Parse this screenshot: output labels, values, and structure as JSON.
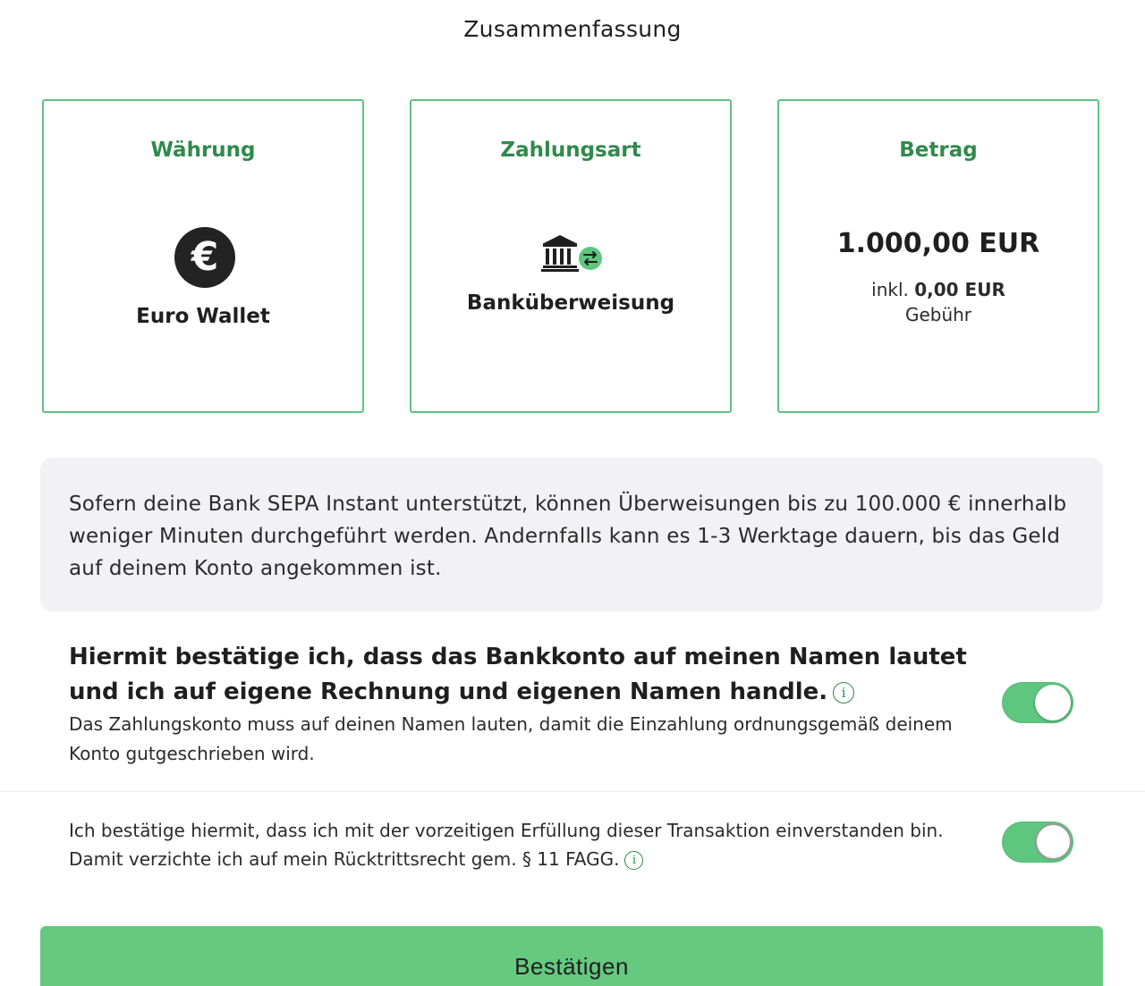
{
  "page": {
    "title": "Zusammenfassung"
  },
  "cards": {
    "currency": {
      "heading": "Währung",
      "icon": "euro-icon",
      "icon_symbol": "€",
      "label": "Euro Wallet"
    },
    "payment_method": {
      "heading": "Zahlungsart",
      "icon": "bank-transfer-icon",
      "label": "Banküberweisung"
    },
    "amount": {
      "heading": "Betrag",
      "value": "1.000,00 EUR",
      "fee_prefix": "inkl.",
      "fee_value": "0,00 EUR",
      "fee_suffix": "Gebühr"
    }
  },
  "info": {
    "text": "Sofern deine Bank SEPA Instant unterstützt, können Überweisungen bis zu 100.000 € innerhalb weniger Minuten durchgeführt werden. Andernfalls kann es 1-3 Werktage dauern, bis das Geld auf deinem Konto angekommen ist."
  },
  "confirmations": {
    "account_owner": {
      "title": "Hiermit bestätige ich, dass das Bankkonto auf meinen Namen lautet und ich auf eigene Rechnung und eigenen Namen handle.",
      "description": "Das Zahlungskonto muss auf deinen Namen lauten, damit die Einzahlung ordnungsgemäß deinem Konto gutgeschrieben wird.",
      "checked": true
    },
    "early_fulfillment": {
      "text": "Ich bestätige hiermit, dass ich mit der vorzeitigen Erfüllung dieser Transaktion einverstanden bin. Damit verzichte ich auf mein Rücktrittsrecht gem. § 11 FAGG.",
      "checked": true
    }
  },
  "info_icon_glyph": "i",
  "submit": {
    "label": "Bestätigen"
  },
  "colors": {
    "accent": "#5cc47e",
    "heading_green": "#2f8a4c",
    "button": "#65c980",
    "info_bg": "#f1f1f6"
  }
}
